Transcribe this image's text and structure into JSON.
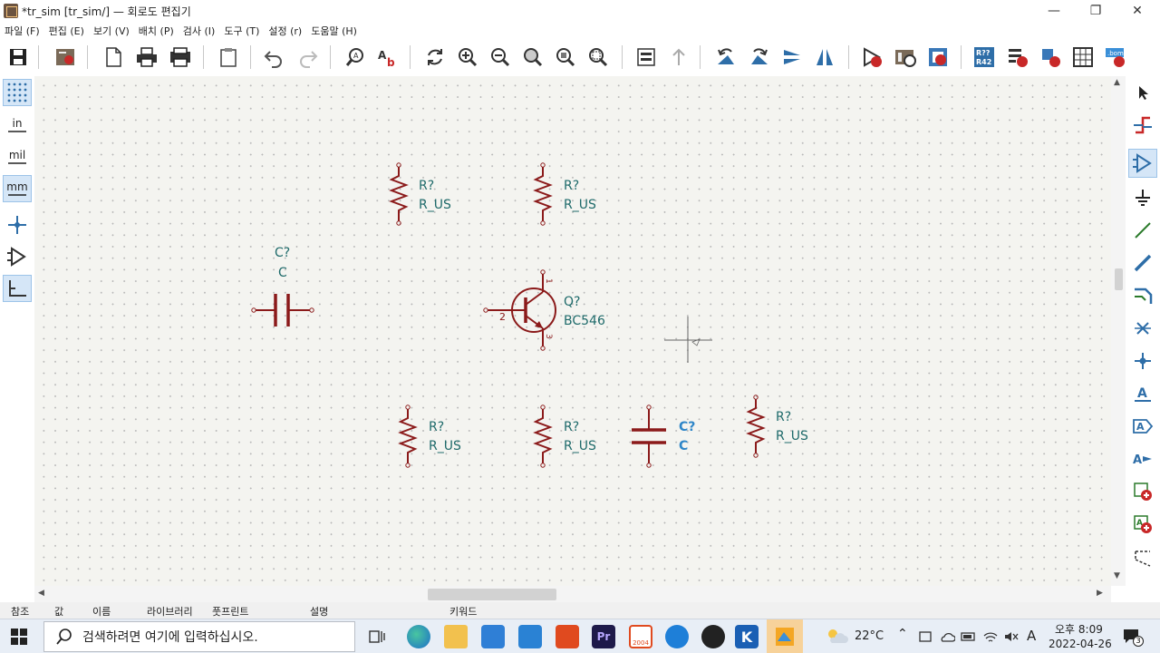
{
  "window": {
    "title": "*tr_sim [tr_sim/] — 회로도 편집기",
    "minimize_glyph": "—",
    "restore_glyph": "❐",
    "close_glyph": "✕"
  },
  "menu": [
    "파일 (F)",
    "편집 (E)",
    "보기 (V)",
    "배치 (P)",
    "검사 (I)",
    "도구 (T)",
    "설정 (r)",
    "도움말 (H)"
  ],
  "left_toolbar": {
    "inch_label": "in",
    "mil_label": "mil",
    "mm_label": "mm"
  },
  "schematic": {
    "wire_color": "#8b1a1a",
    "text_color": "#1e6a6a",
    "selected_color": "#2e86c8",
    "components": {
      "r1": {
        "ref": "R?",
        "value": "R_US"
      },
      "r2": {
        "ref": "R?",
        "value": "R_US"
      },
      "c1": {
        "ref": "C?",
        "value": "C"
      },
      "q1": {
        "ref": "Q?",
        "value": "BC546",
        "pin_b": "2",
        "pin_c": "1",
        "pin_e": "3"
      },
      "r3": {
        "ref": "R?",
        "value": "R_US"
      },
      "r4": {
        "ref": "R?",
        "value": "R_US"
      },
      "c2": {
        "ref": "C?",
        "value": "C"
      },
      "r5": {
        "ref": "R?",
        "value": "R_US"
      }
    }
  },
  "statusbar": {
    "ref": "참조",
    "value": "값",
    "name": "이름",
    "library": "라이브러리",
    "footprint": "풋프린트",
    "description": "설명",
    "keywords": "키워드"
  },
  "taskbar": {
    "search_placeholder": "검색하려면 여기에 입력하십시오.",
    "temperature": "22°C",
    "ime": "A",
    "time": "오후 8:09",
    "date": "2022-04-26",
    "notif_count": "3",
    "office_badge": "2004"
  }
}
